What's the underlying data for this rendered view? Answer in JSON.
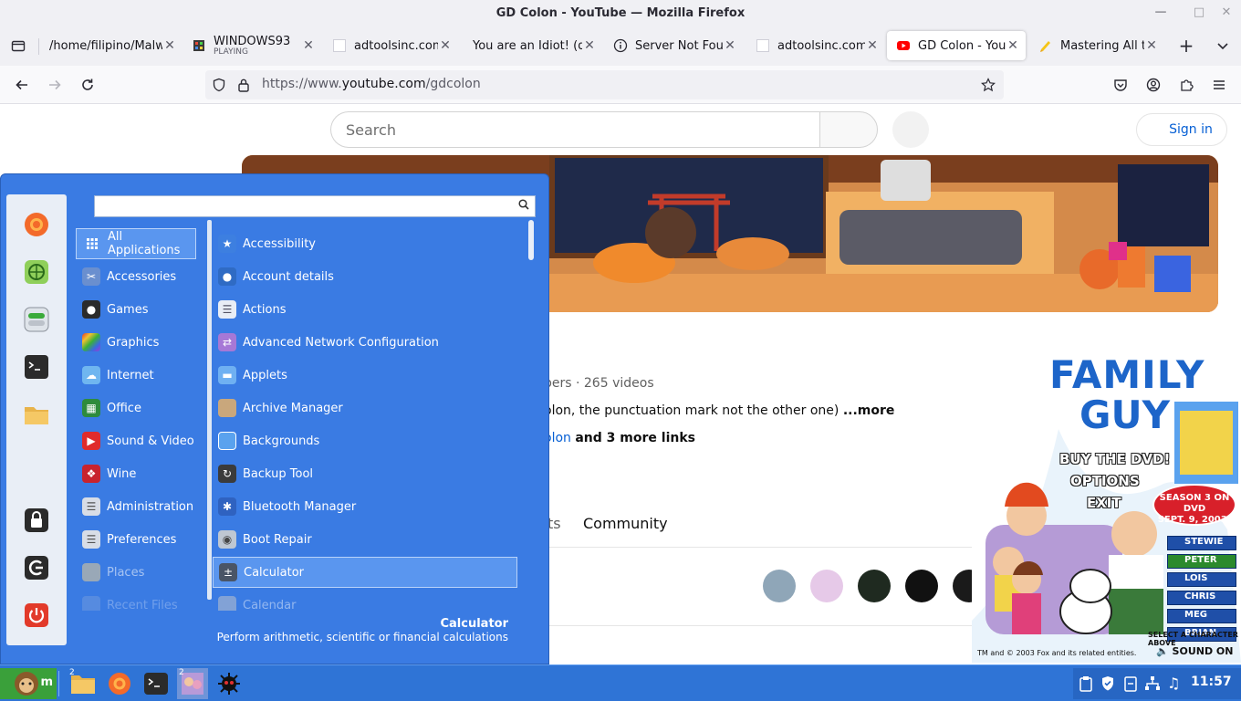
{
  "window": {
    "title": "GD Colon - YouTube — Mozilla Firefox"
  },
  "tabs": [
    {
      "title": "/home/filipino/Malw",
      "sub": ""
    },
    {
      "title": "WINDOWS93",
      "sub": "PLAYING"
    },
    {
      "title": "adtoolsinc.com",
      "sub": ""
    },
    {
      "title": "You are an Idiot! (do",
      "sub": ""
    },
    {
      "title": "Server Not Found",
      "sub": ""
    },
    {
      "title": "adtoolsinc.com",
      "sub": ""
    },
    {
      "title": "GD Colon - YouTube",
      "sub": ""
    },
    {
      "title": "Mastering All the",
      "sub": ""
    }
  ],
  "nav": {
    "url_prefix": "https://www.",
    "url_domain": "youtube.com",
    "url_path": "/gdcolon"
  },
  "youtube": {
    "search_placeholder": "Search",
    "signin": "Sign in",
    "subs_videos": "bers · 265 videos",
    "desc": "olon, the punctuation mark not the other one)",
    "more": "...more",
    "link": "olon",
    "more_links": "and 3 more links",
    "tab_partial": "ts",
    "tab_community": "Community"
  },
  "popup": {
    "brand_line1": "FAMILY",
    "brand_line2": "GUY",
    "buy": "BUY THE DVD!",
    "options": "OPTIONS",
    "exit": "EXIT",
    "season": "SEASON 3 ON DVD",
    "season_date": "SEPT. 9, 2003!",
    "characters": [
      "STEWIE",
      "PETER",
      "LOIS",
      "CHRIS",
      "MEG",
      "BRIAN"
    ],
    "select_hint": "SELECT A CHARACTER ABOVE",
    "sound": "SOUND ON",
    "copyright": "TM and © 2003 Fox and its related entities."
  },
  "menu": {
    "categories": [
      {
        "label": "All Applications",
        "icon": "grid-icon",
        "color": "#5a96ef"
      },
      {
        "label": "Accessories",
        "icon": "scissors-icon",
        "color": "#6a8fcf"
      },
      {
        "label": "Games",
        "icon": "gamepad-icon",
        "color": "#2b2b2b"
      },
      {
        "label": "Graphics",
        "icon": "palette-icon",
        "color": "#c0399a"
      },
      {
        "label": "Internet",
        "icon": "cloud-icon",
        "color": "#6fb6f0"
      },
      {
        "label": "Office",
        "icon": "office-icon",
        "color": "#2e8b3c"
      },
      {
        "label": "Sound & Video",
        "icon": "play-icon",
        "color": "#e02b2b"
      },
      {
        "label": "Wine",
        "icon": "wine-icon",
        "color": "#c8232e"
      },
      {
        "label": "Administration",
        "icon": "admin-icon",
        "color": "#d8dde6"
      },
      {
        "label": "Preferences",
        "icon": "prefs-icon",
        "color": "#d8dde6"
      },
      {
        "label": "Places",
        "icon": "folder-icon",
        "color": "#d8c69a"
      },
      {
        "label": "Recent Files",
        "icon": "recent-icon",
        "color": "#9ab2d8"
      }
    ],
    "apps": [
      {
        "label": "Accessibility",
        "icon": "accessibility-icon",
        "color": "#3d7fe0"
      },
      {
        "label": "Account details",
        "icon": "account-icon",
        "color": "#2f6bc4"
      },
      {
        "label": "Actions",
        "icon": "actions-icon",
        "color": "#e8edf5"
      },
      {
        "label": "Advanced Network Configuration",
        "icon": "network-icon",
        "color": "#a678d6"
      },
      {
        "label": "Applets",
        "icon": "applets-icon",
        "color": "#6fb0f2"
      },
      {
        "label": "Archive Manager",
        "icon": "archive-icon",
        "color": "#c9a77c"
      },
      {
        "label": "Backgrounds",
        "icon": "backgrounds-icon",
        "color": "#5aa2ee"
      },
      {
        "label": "Backup Tool",
        "icon": "backup-icon",
        "color": "#3b3b3b"
      },
      {
        "label": "Bluetooth Manager",
        "icon": "bluetooth-icon",
        "color": "#2f62c0"
      },
      {
        "label": "Boot Repair",
        "icon": "boot-repair-icon",
        "color": "#bfc7d2"
      },
      {
        "label": "Calculator",
        "icon": "calculator-icon",
        "color": "#4a5566"
      },
      {
        "label": "Calendar",
        "icon": "calendar-icon",
        "color": "#c9c9c9"
      }
    ],
    "selected_title": "Calculator",
    "selected_desc": "Perform arithmetic, scientific or financial calculations"
  },
  "taskbar": {
    "clock": "11:57",
    "badge1": "2",
    "badge2": "2"
  }
}
